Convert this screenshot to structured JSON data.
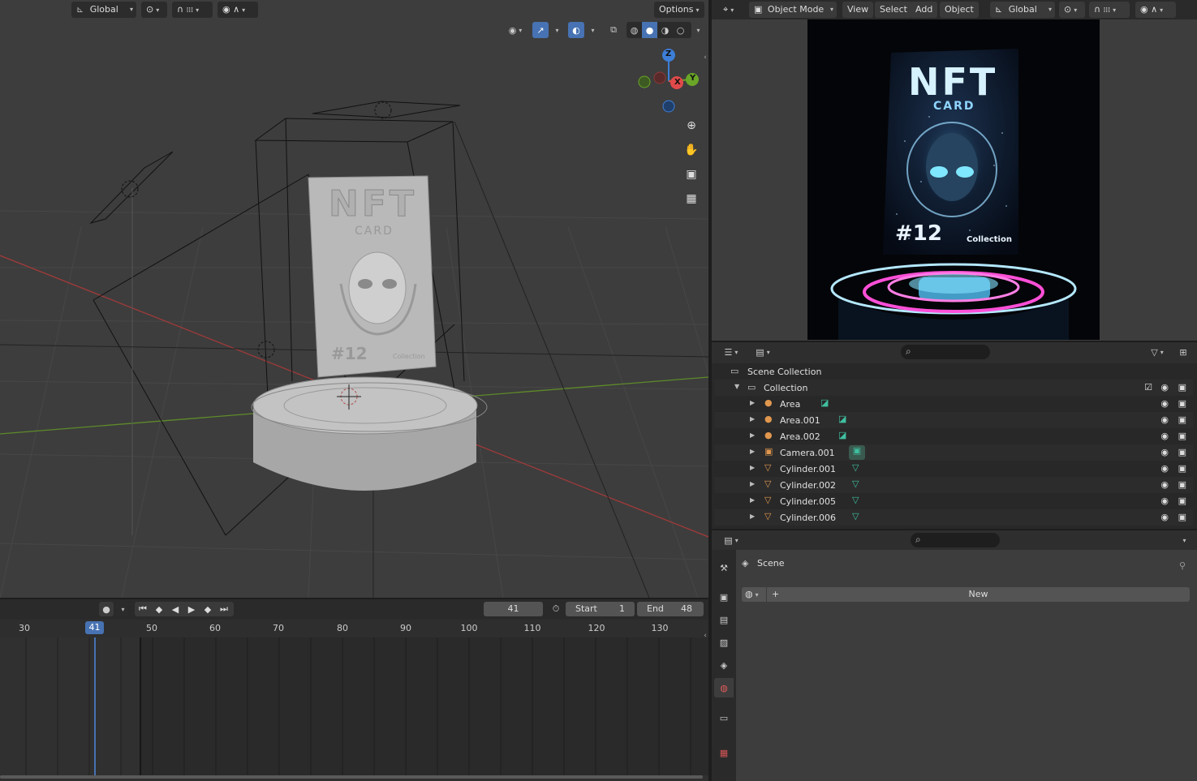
{
  "viewport_header": {
    "transform_orientation": "Global",
    "options_label": "Options"
  },
  "render_header": {
    "mode": "Object Mode",
    "menus": [
      "View",
      "Select",
      "Add",
      "Object"
    ],
    "transform_orientation": "Global"
  },
  "gizmo": {
    "z": "Z",
    "y": "Y",
    "x": "X"
  },
  "card": {
    "title": "NFT",
    "subtitle": "CARD",
    "number": "#12",
    "collection": "Collection"
  },
  "timeline": {
    "current_frame": "41",
    "start_label": "Start",
    "start_value": "1",
    "end_label": "End",
    "end_value": "48",
    "ruler": [
      "30",
      "41",
      "50",
      "60",
      "70",
      "80",
      "90",
      "100",
      "110",
      "120",
      "130"
    ]
  },
  "outliner": {
    "scene_collection": "Scene Collection",
    "collection": "Collection",
    "items": [
      {
        "name": "Area",
        "type": "light"
      },
      {
        "name": "Area.001",
        "type": "light"
      },
      {
        "name": "Area.002",
        "type": "light"
      },
      {
        "name": "Camera.001",
        "type": "camera"
      },
      {
        "name": "Cylinder.001",
        "type": "mesh"
      },
      {
        "name": "Cylinder.002",
        "type": "mesh"
      },
      {
        "name": "Cylinder.005",
        "type": "mesh"
      },
      {
        "name": "Cylinder.006",
        "type": "mesh"
      }
    ]
  },
  "properties": {
    "context": "Scene",
    "new_label": "New",
    "tabs": [
      "tool",
      "render",
      "output",
      "view-layer",
      "scene",
      "world",
      "collection",
      "texture"
    ]
  },
  "colors": {
    "accent_blue": "#4772b3",
    "x_axis": "#e14a4a",
    "y_axis": "#6aa627",
    "z_axis": "#3d7ed6",
    "light_icon": "#e0974e",
    "mesh_data": "#3fbf9f"
  }
}
